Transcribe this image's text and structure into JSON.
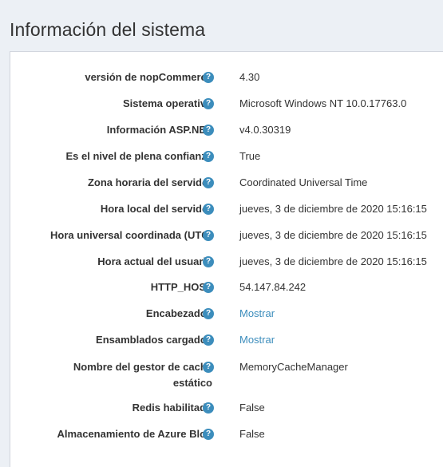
{
  "page": {
    "title": "Información del sistema"
  },
  "help_icon_glyph": "?",
  "rows": [
    {
      "label": "versión de nopCommerce",
      "value": "4.30"
    },
    {
      "label": "Sistema operativo",
      "value": "Microsoft Windows NT 10.0.17763.0"
    },
    {
      "label": "Información ASP.NET",
      "value": "v4.0.30319"
    },
    {
      "label": "Es el nivel de plena confianza",
      "value": "True"
    },
    {
      "label": "Zona horaria del servidor",
      "value": "Coordinated Universal Time"
    },
    {
      "label": "Hora local del servidor",
      "value": "jueves, 3 de diciembre de 2020 15:16:15"
    },
    {
      "label": "Hora universal coordinada (UTC)",
      "value": "jueves, 3 de diciembre de 2020 15:16:15"
    },
    {
      "label": "Hora actual del usuario",
      "value": "jueves, 3 de diciembre de 2020 15:16:15"
    },
    {
      "label": "HTTP_HOST",
      "value": "54.147.84.242"
    },
    {
      "label": "Encabezados",
      "value": "Mostrar"
    },
    {
      "label": "Ensamblados cargados",
      "value": "Mostrar"
    },
    {
      "label_line1": "Nombre del gestor de caché",
      "label_line2": "estático",
      "value": "MemoryCacheManager"
    },
    {
      "label": "Redis habilitado",
      "value": "False"
    },
    {
      "label": "Almacenamiento de Azure Blob",
      "value": "False"
    }
  ],
  "colors": {
    "accent": "#3c8dbc",
    "background": "#ecf0f5",
    "panel": "#ffffff"
  }
}
